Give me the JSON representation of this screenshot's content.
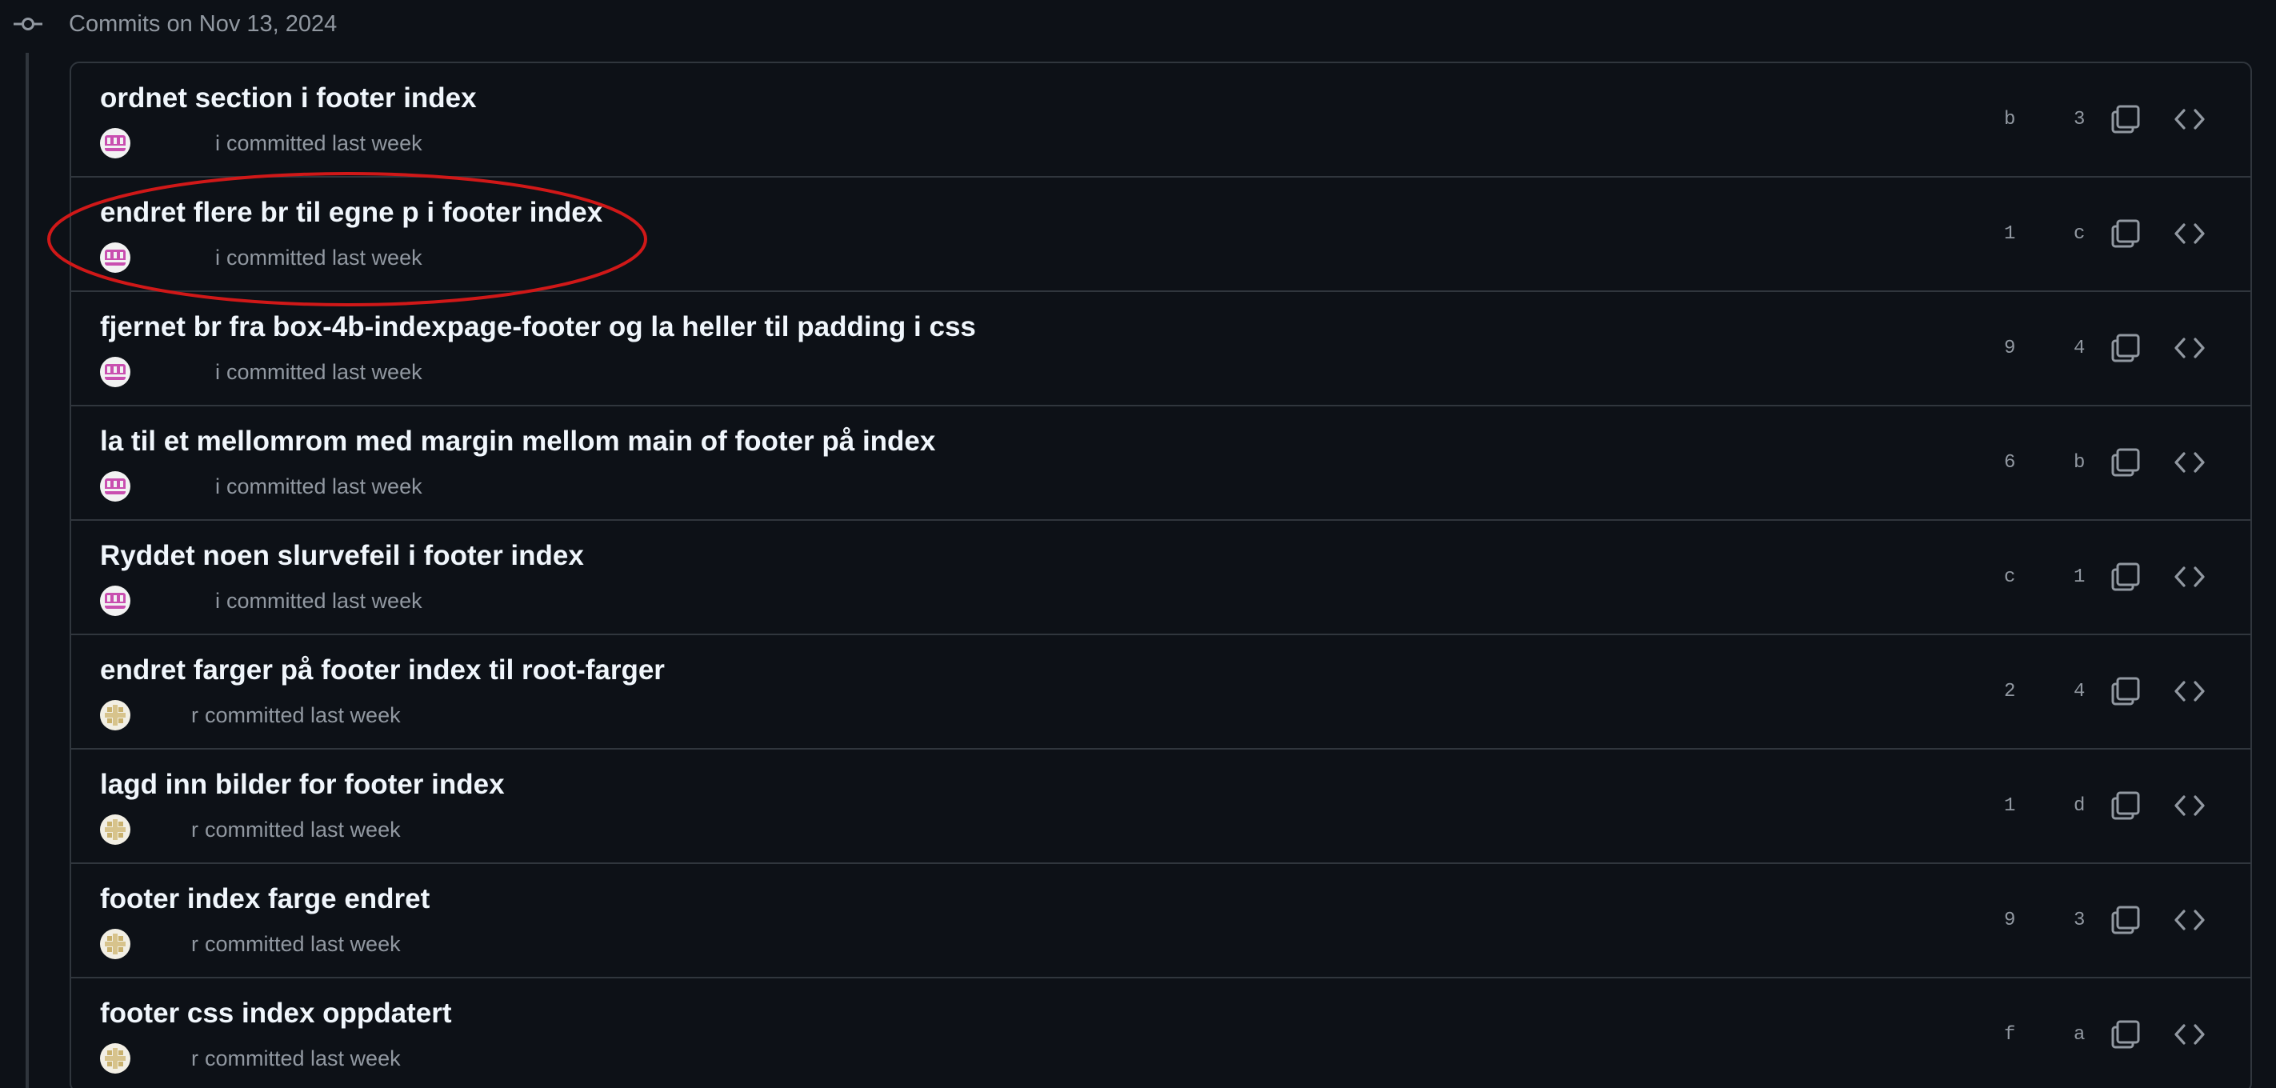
{
  "header": {
    "title": "Commits on Nov 13, 2024",
    "icon": "git-commit-icon"
  },
  "commits": [
    {
      "message": "ordnet section i footer index",
      "author": "i",
      "action": "committed last week",
      "sha_a": "b",
      "sha_b": "3",
      "avatar": "pink"
    },
    {
      "message": "endret flere br til egne p i footer index",
      "author": "i",
      "action": "committed last week",
      "sha_a": "1",
      "sha_b": "c",
      "avatar": "pink"
    },
    {
      "message": "fjernet br fra box-4b-indexpage-footer og la heller til padding i css",
      "author": "i",
      "action": "committed last week",
      "sha_a": "9",
      "sha_b": "4",
      "avatar": "pink"
    },
    {
      "message": "la til et mellomrom med margin mellom main of footer på index",
      "author": "i",
      "action": "committed last week",
      "sha_a": "6",
      "sha_b": "b",
      "avatar": "pink"
    },
    {
      "message": "Ryddet noen slurvefeil i footer index",
      "author": "i",
      "action": "committed last week",
      "sha_a": "c",
      "sha_b": "1",
      "avatar": "pink"
    },
    {
      "message": "endret farger på footer index til root-farger",
      "author": "r",
      "action": "committed last week",
      "sha_a": "2",
      "sha_b": "4",
      "avatar": "tan"
    },
    {
      "message": "lagd inn bilder for footer index",
      "author": "r",
      "action": "committed last week",
      "sha_a": "1",
      "sha_b": "d",
      "avatar": "tan"
    },
    {
      "message": "footer index farge endret",
      "author": "r",
      "action": "committed last week",
      "sha_a": "9",
      "sha_b": "3",
      "avatar": "tan"
    },
    {
      "message": "footer css index oppdatert",
      "author": "r",
      "action": "committed last week",
      "sha_a": "f",
      "sha_b": "a",
      "avatar": "tan"
    }
  ],
  "icons": {
    "copy": "copy-icon",
    "browse": "code-icon"
  },
  "colors": {
    "background": "#0d1117",
    "border": "#30363d",
    "muted_text": "#9198a1",
    "annotation": "#d01818"
  }
}
